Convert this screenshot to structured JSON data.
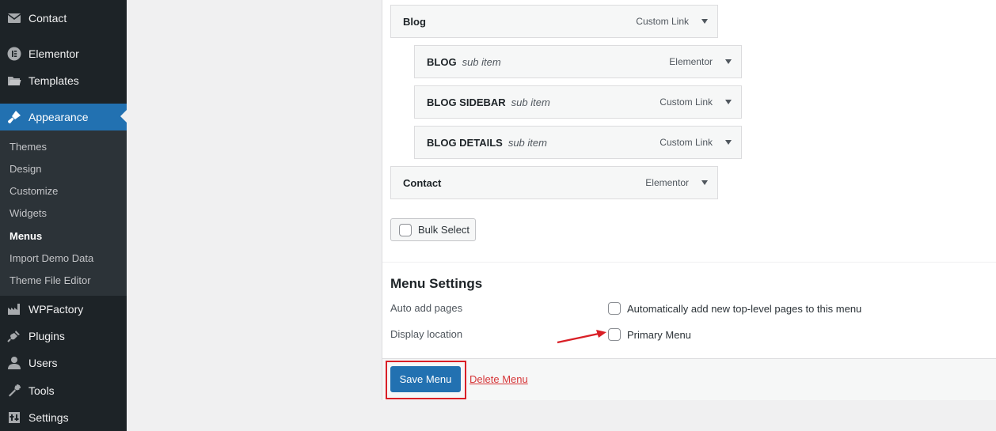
{
  "sidebar": {
    "top_items": [
      {
        "label": "Contact",
        "icon": "mail-icon"
      },
      {
        "label": "Elementor",
        "icon": "elementor-icon"
      },
      {
        "label": "Templates",
        "icon": "folder-icon"
      },
      {
        "label": "Appearance",
        "icon": "paintbrush-icon"
      }
    ],
    "submenu": [
      "Themes",
      "Design",
      "Customize",
      "Widgets",
      "Menus",
      "Import Demo Data",
      "Theme File Editor"
    ],
    "bottom_items": [
      {
        "label": "WPFactory",
        "icon": "factory-icon"
      },
      {
        "label": "Plugins",
        "icon": "plugin-icon"
      },
      {
        "label": "Users",
        "icon": "user-icon"
      },
      {
        "label": "Tools",
        "icon": "wrench-icon"
      },
      {
        "label": "Settings",
        "icon": "settings-icon"
      }
    ]
  },
  "menu_items": [
    {
      "title": "Blog",
      "sub": "",
      "type": "Custom Link"
    },
    {
      "title": "BLOG",
      "sub": "sub item",
      "type": "Elementor"
    },
    {
      "title": "BLOG SIDEBAR",
      "sub": "sub item",
      "type": "Custom Link"
    },
    {
      "title": "BLOG DETAILS",
      "sub": "sub item",
      "type": "Custom Link"
    },
    {
      "title": "Contact",
      "sub": "",
      "type": "Elementor"
    }
  ],
  "bulk_select_label": "Bulk Select",
  "settings": {
    "title": "Menu Settings",
    "auto_add_label": "Auto add pages",
    "auto_add_option": "Automatically add new top-level pages to this menu",
    "display_location_label": "Display location",
    "display_location_option": "Primary Menu"
  },
  "footer": {
    "save_label": "Save Menu",
    "delete_label": "Delete Menu"
  },
  "colors": {
    "sidebar_bg": "#1d2327",
    "accent": "#2271b1",
    "annotation": "#d91f26",
    "delete_link": "#d63638"
  }
}
